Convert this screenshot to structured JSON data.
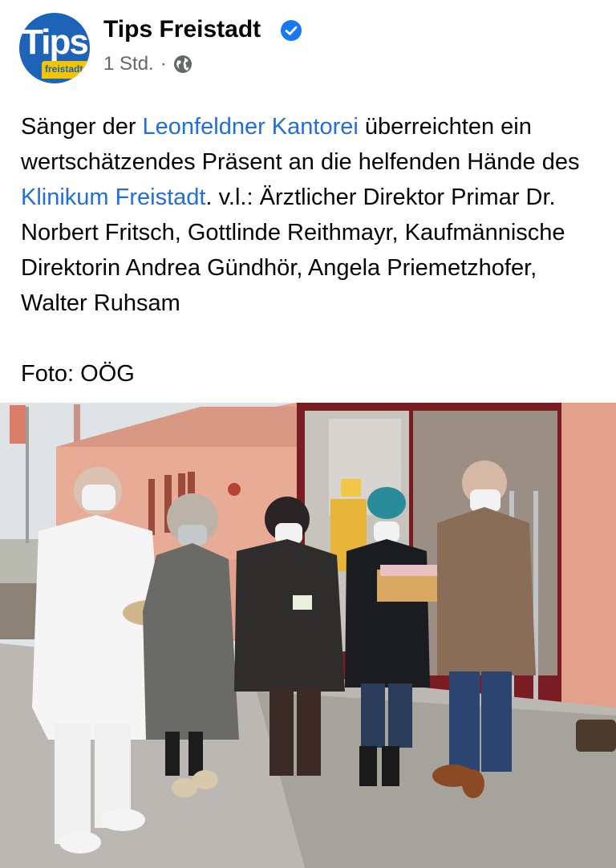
{
  "post": {
    "page_name": "Tips Freistadt",
    "logo_text": "Tips",
    "logo_subtext": "freistadt",
    "timestamp": "1 Std.",
    "separator": "·",
    "icons": {
      "verified": "verified-badge-icon",
      "audience": "globe-icon"
    },
    "caption": {
      "part1": "Sänger der ",
      "link1": "Leonfeldner Kantorei",
      "part2": " überreichten ein wertschätzendes Präsent an die helfenden Hände des ",
      "link2": "Klinikum Freistadt",
      "part3": ". v.l.: Ärztlicher Direktor Primar Dr. Norbert Fritsch, Gottlinde Reithmayr, Kaufmännische Direktorin Andrea Gündhör, Angela Priemetzhofer, Walter Ruhsam",
      "credit": "Foto: OÖG"
    }
  },
  "colors": {
    "link": "#216fdb",
    "brand_blue": "#1d63b8",
    "brand_yellow": "#f4c400",
    "secondary_text": "#65676b"
  }
}
